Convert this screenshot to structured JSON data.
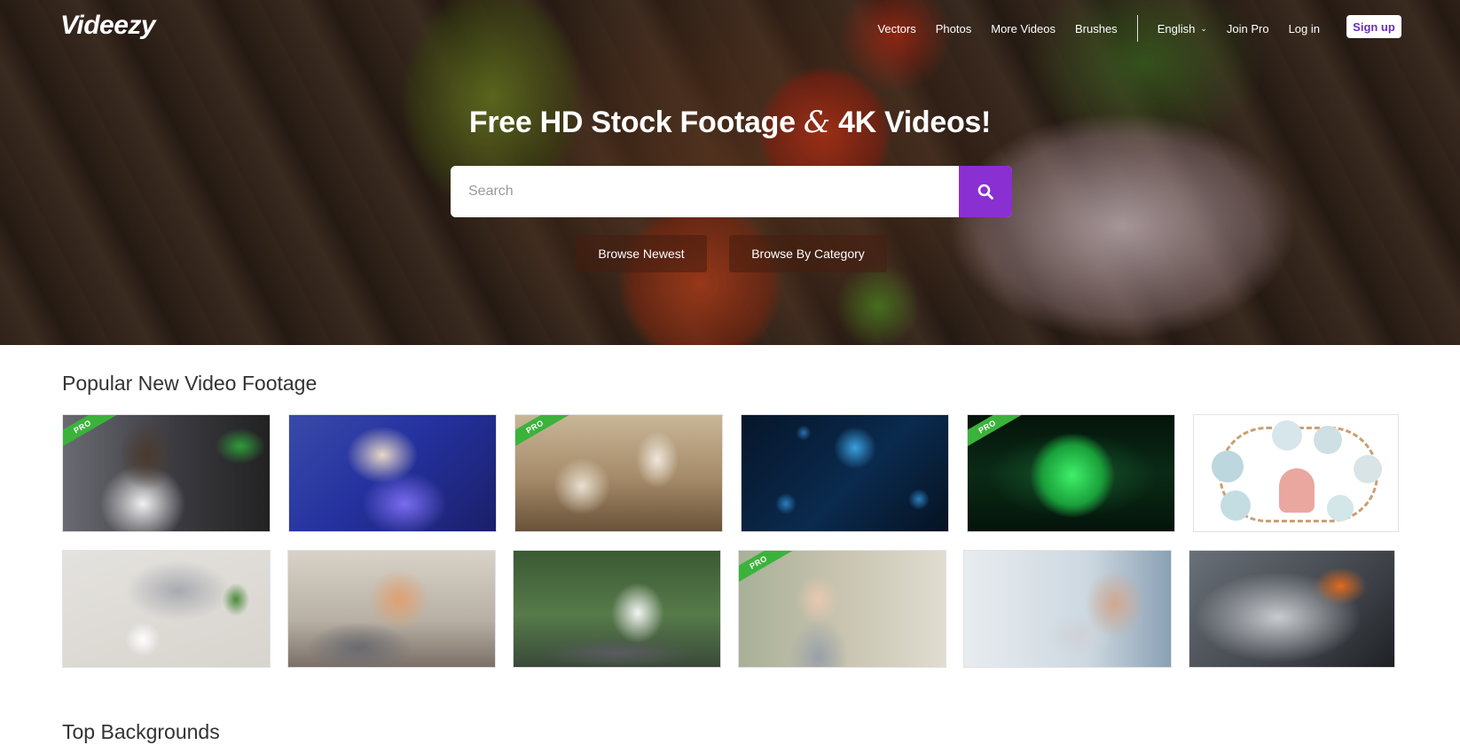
{
  "header": {
    "logo": "Videezy",
    "nav": [
      "Vectors",
      "Photos",
      "More Videos",
      "Brushes"
    ],
    "language": "English",
    "join_pro": "Join Pro",
    "login": "Log in",
    "signup": "Sign up"
  },
  "hero": {
    "title_part1": "Free HD Stock Footage",
    "title_amp": "&",
    "title_part2": "4K Videos!",
    "search_placeholder": "Search",
    "browse_newest": "Browse Newest",
    "browse_category": "Browse By Category"
  },
  "sections": {
    "popular_title": "Popular New Video Footage",
    "backgrounds_title": "Top Backgrounds"
  },
  "badges": {
    "pro": "PRO"
  },
  "thumbnails": [
    {
      "subject": "scientist at microscope",
      "pro": true
    },
    {
      "subject": "lab pipette blue",
      "pro": false
    },
    {
      "subject": "laboratory glassware",
      "pro": true
    },
    {
      "subject": "blue virus particles",
      "pro": false
    },
    {
      "subject": "green glowing sphere",
      "pro": true
    },
    {
      "subject": "online shopping illustration",
      "pro": false
    },
    {
      "subject": "typing on laptop",
      "pro": false
    },
    {
      "subject": "couple on couch",
      "pro": false
    },
    {
      "subject": "woman drinking tea at desk",
      "pro": false
    },
    {
      "subject": "woman in mask thumbs up",
      "pro": true
    },
    {
      "subject": "stressed man at laptop",
      "pro": false
    },
    {
      "subject": "cleaning glove",
      "pro": false
    }
  ],
  "colors": {
    "accent": "#8a2fd1",
    "signup_text": "#6b2fb5",
    "pro_badge": "#3bb33b"
  },
  "icons": {
    "search": "search-icon",
    "language_dropdown": "chevron-down-icon"
  }
}
